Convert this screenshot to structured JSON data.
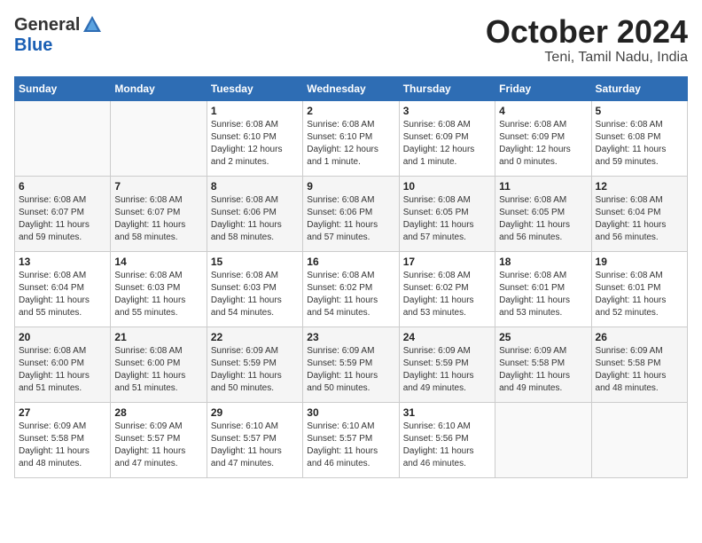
{
  "header": {
    "logo_general": "General",
    "logo_blue": "Blue",
    "month_title": "October 2024",
    "location": "Teni, Tamil Nadu, India"
  },
  "calendar": {
    "days_of_week": [
      "Sunday",
      "Monday",
      "Tuesday",
      "Wednesday",
      "Thursday",
      "Friday",
      "Saturday"
    ],
    "weeks": [
      [
        {
          "day": "",
          "info": ""
        },
        {
          "day": "",
          "info": ""
        },
        {
          "day": "1",
          "info": "Sunrise: 6:08 AM\nSunset: 6:10 PM\nDaylight: 12 hours\nand 2 minutes."
        },
        {
          "day": "2",
          "info": "Sunrise: 6:08 AM\nSunset: 6:10 PM\nDaylight: 12 hours\nand 1 minute."
        },
        {
          "day": "3",
          "info": "Sunrise: 6:08 AM\nSunset: 6:09 PM\nDaylight: 12 hours\nand 1 minute."
        },
        {
          "day": "4",
          "info": "Sunrise: 6:08 AM\nSunset: 6:09 PM\nDaylight: 12 hours\nand 0 minutes."
        },
        {
          "day": "5",
          "info": "Sunrise: 6:08 AM\nSunset: 6:08 PM\nDaylight: 11 hours\nand 59 minutes."
        }
      ],
      [
        {
          "day": "6",
          "info": "Sunrise: 6:08 AM\nSunset: 6:07 PM\nDaylight: 11 hours\nand 59 minutes."
        },
        {
          "day": "7",
          "info": "Sunrise: 6:08 AM\nSunset: 6:07 PM\nDaylight: 11 hours\nand 58 minutes."
        },
        {
          "day": "8",
          "info": "Sunrise: 6:08 AM\nSunset: 6:06 PM\nDaylight: 11 hours\nand 58 minutes."
        },
        {
          "day": "9",
          "info": "Sunrise: 6:08 AM\nSunset: 6:06 PM\nDaylight: 11 hours\nand 57 minutes."
        },
        {
          "day": "10",
          "info": "Sunrise: 6:08 AM\nSunset: 6:05 PM\nDaylight: 11 hours\nand 57 minutes."
        },
        {
          "day": "11",
          "info": "Sunrise: 6:08 AM\nSunset: 6:05 PM\nDaylight: 11 hours\nand 56 minutes."
        },
        {
          "day": "12",
          "info": "Sunrise: 6:08 AM\nSunset: 6:04 PM\nDaylight: 11 hours\nand 56 minutes."
        }
      ],
      [
        {
          "day": "13",
          "info": "Sunrise: 6:08 AM\nSunset: 6:04 PM\nDaylight: 11 hours\nand 55 minutes."
        },
        {
          "day": "14",
          "info": "Sunrise: 6:08 AM\nSunset: 6:03 PM\nDaylight: 11 hours\nand 55 minutes."
        },
        {
          "day": "15",
          "info": "Sunrise: 6:08 AM\nSunset: 6:03 PM\nDaylight: 11 hours\nand 54 minutes."
        },
        {
          "day": "16",
          "info": "Sunrise: 6:08 AM\nSunset: 6:02 PM\nDaylight: 11 hours\nand 54 minutes."
        },
        {
          "day": "17",
          "info": "Sunrise: 6:08 AM\nSunset: 6:02 PM\nDaylight: 11 hours\nand 53 minutes."
        },
        {
          "day": "18",
          "info": "Sunrise: 6:08 AM\nSunset: 6:01 PM\nDaylight: 11 hours\nand 53 minutes."
        },
        {
          "day": "19",
          "info": "Sunrise: 6:08 AM\nSunset: 6:01 PM\nDaylight: 11 hours\nand 52 minutes."
        }
      ],
      [
        {
          "day": "20",
          "info": "Sunrise: 6:08 AM\nSunset: 6:00 PM\nDaylight: 11 hours\nand 51 minutes."
        },
        {
          "day": "21",
          "info": "Sunrise: 6:08 AM\nSunset: 6:00 PM\nDaylight: 11 hours\nand 51 minutes."
        },
        {
          "day": "22",
          "info": "Sunrise: 6:09 AM\nSunset: 5:59 PM\nDaylight: 11 hours\nand 50 minutes."
        },
        {
          "day": "23",
          "info": "Sunrise: 6:09 AM\nSunset: 5:59 PM\nDaylight: 11 hours\nand 50 minutes."
        },
        {
          "day": "24",
          "info": "Sunrise: 6:09 AM\nSunset: 5:59 PM\nDaylight: 11 hours\nand 49 minutes."
        },
        {
          "day": "25",
          "info": "Sunrise: 6:09 AM\nSunset: 5:58 PM\nDaylight: 11 hours\nand 49 minutes."
        },
        {
          "day": "26",
          "info": "Sunrise: 6:09 AM\nSunset: 5:58 PM\nDaylight: 11 hours\nand 48 minutes."
        }
      ],
      [
        {
          "day": "27",
          "info": "Sunrise: 6:09 AM\nSunset: 5:58 PM\nDaylight: 11 hours\nand 48 minutes."
        },
        {
          "day": "28",
          "info": "Sunrise: 6:09 AM\nSunset: 5:57 PM\nDaylight: 11 hours\nand 47 minutes."
        },
        {
          "day": "29",
          "info": "Sunrise: 6:10 AM\nSunset: 5:57 PM\nDaylight: 11 hours\nand 47 minutes."
        },
        {
          "day": "30",
          "info": "Sunrise: 6:10 AM\nSunset: 5:57 PM\nDaylight: 11 hours\nand 46 minutes."
        },
        {
          "day": "31",
          "info": "Sunrise: 6:10 AM\nSunset: 5:56 PM\nDaylight: 11 hours\nand 46 minutes."
        },
        {
          "day": "",
          "info": ""
        },
        {
          "day": "",
          "info": ""
        }
      ]
    ]
  }
}
